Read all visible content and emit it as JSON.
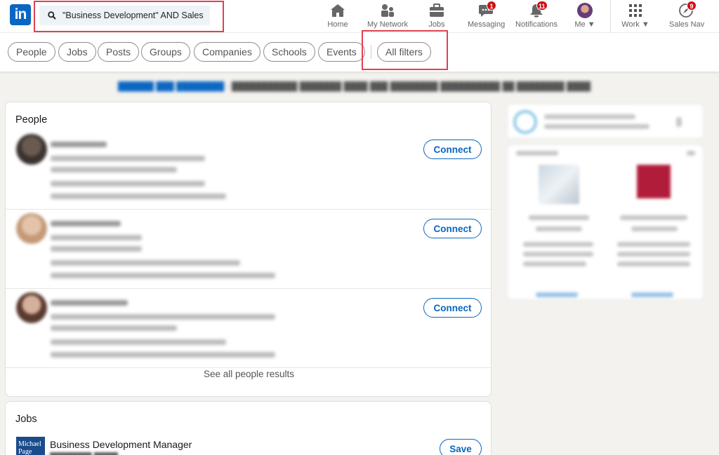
{
  "header": {
    "logo": "in",
    "search": {
      "value": "\"Business Development\" AND Sales"
    },
    "nav": [
      {
        "label": "Home",
        "icon": "home-icon"
      },
      {
        "label": "My Network",
        "icon": "network-icon"
      },
      {
        "label": "Jobs",
        "icon": "briefcase-icon"
      },
      {
        "label": "Messaging",
        "icon": "chat-icon",
        "badge": "1"
      },
      {
        "label": "Notifications",
        "icon": "bell-icon",
        "badge": "11"
      },
      {
        "label": "Me",
        "icon": "avatar"
      },
      {
        "label": "Work",
        "icon": "grid-icon"
      },
      {
        "label": "Sales Nav",
        "icon": "compass-icon",
        "badge": "9"
      }
    ]
  },
  "filters": {
    "pills": [
      "People",
      "Jobs",
      "Posts",
      "Groups",
      "Companies",
      "Schools",
      "Events"
    ],
    "all_filters": "All filters"
  },
  "people": {
    "title": "People",
    "connect_label": "Connect",
    "see_all": "See all people results"
  },
  "jobs": {
    "title": "Jobs",
    "items": [
      {
        "title": "Business Development Manager",
        "logo_text": "Michael Page",
        "action": "Save"
      }
    ]
  },
  "colors": {
    "brand": "#0a66c2",
    "badge": "#cc1016",
    "highlight": "#e0414f"
  }
}
